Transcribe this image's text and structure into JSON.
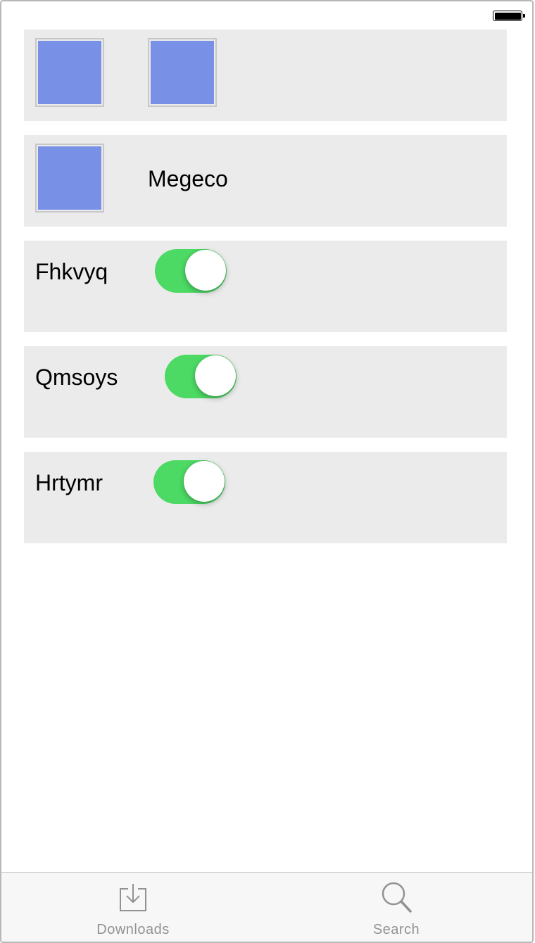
{
  "colors": {
    "card_background": "#ebebeb",
    "thumbnail": "#7890e6",
    "toggle_on": "#4cd964",
    "tab_inactive": "#929292"
  },
  "rows": {
    "row2": {
      "label": "Megeco"
    },
    "row3": {
      "label": "Fhkvyq",
      "toggle_on": true
    },
    "row4": {
      "label": "Qmsoys",
      "toggle_on": true
    },
    "row5": {
      "label": "Hrtymr",
      "toggle_on": true
    }
  },
  "tabs": {
    "downloads": {
      "label": "Downloads",
      "icon": "download-tray-icon"
    },
    "search": {
      "label": "Search",
      "icon": "magnifier-icon"
    }
  }
}
